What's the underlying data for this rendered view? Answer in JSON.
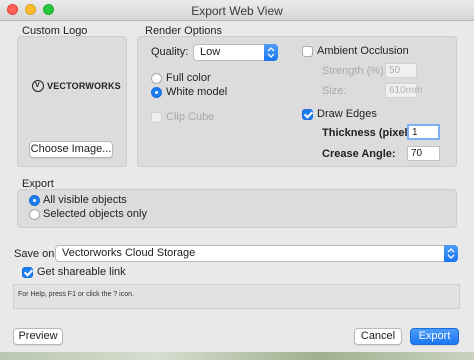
{
  "window": {
    "title": "Export Web View"
  },
  "custom_logo": {
    "label": "Custom Logo",
    "logo_text": "VECTORWORKS",
    "choose_button": "Choose Image..."
  },
  "render_options": {
    "label": "Render Options",
    "quality_label": "Quality:",
    "quality_value": "Low",
    "full_color": "Full color",
    "white_model": "White model",
    "clip_cube": "Clip Cube",
    "ambient_occlusion": "Ambient Occlusion",
    "strength_label": "Strength (%):",
    "strength_value": "50",
    "size_label": "Size:",
    "size_value": "610mm",
    "draw_edges": "Draw Edges",
    "thickness_label": "Thickness (pixels):",
    "thickness_value": "1",
    "crease_label": "Crease Angle:",
    "crease_value": "70"
  },
  "export": {
    "label": "Export",
    "all_visible": "All visible objects",
    "selected_only": "Selected objects only"
  },
  "save_on": {
    "label": "Save on:",
    "value": "Vectorworks Cloud Storage",
    "shareable_link": "Get shareable link"
  },
  "help_text": "For Help, press F1 or click the ? icon.",
  "buttons": {
    "preview": "Preview",
    "cancel": "Cancel",
    "export": "Export"
  },
  "colors": {
    "accent": "#1d7cf2",
    "close": "#fe5f57",
    "minimize": "#febc2e",
    "zoom": "#28c840"
  }
}
